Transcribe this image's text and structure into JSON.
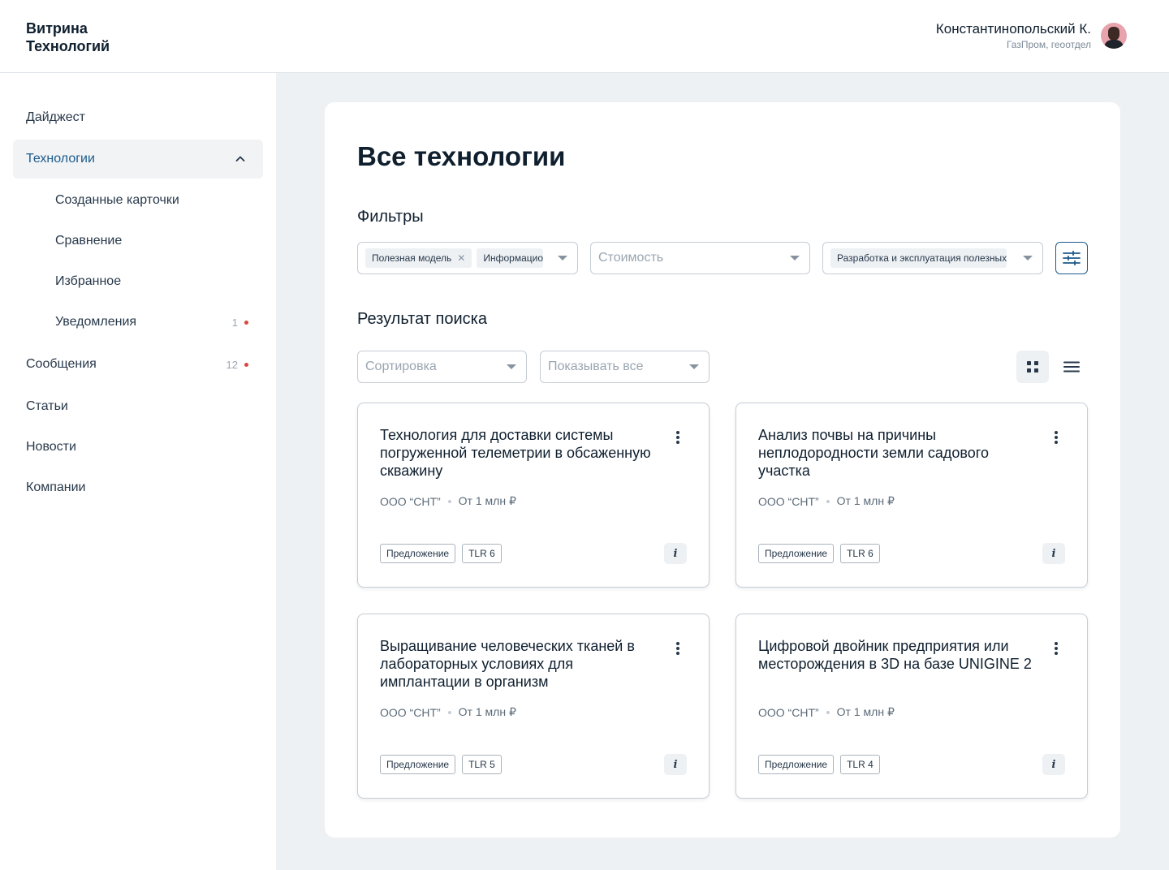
{
  "app": {
    "logo_line1": "Витрина",
    "logo_line2": "Технологий"
  },
  "user": {
    "name": "Константинопольский К.",
    "org": "ГазПром, геоотдел"
  },
  "sidebar": {
    "items": [
      {
        "label": "Дайджест"
      },
      {
        "label": "Технологии",
        "active": true
      },
      {
        "label": "Созданные карточки"
      },
      {
        "label": "Сравнение"
      },
      {
        "label": "Избранное"
      },
      {
        "label": "Уведомления",
        "count": "1"
      },
      {
        "label": "Сообщения",
        "count": "12"
      },
      {
        "label": "Статьи"
      },
      {
        "label": "Новости"
      },
      {
        "label": "Компании"
      }
    ]
  },
  "main": {
    "title": "Все технологии",
    "filters_title": "Фильтры",
    "filters": {
      "type_chips": [
        "Полезная модель",
        "Информацио"
      ],
      "cost_placeholder": "Стоимость",
      "area_chip": "Разработка и эксплуатация полезных"
    },
    "results_title": "Результат поиска",
    "sort_placeholder": "Сортировка",
    "show_placeholder": "Показывать все"
  },
  "cards": [
    {
      "title": "Технология для доставки системы погруженной телеметрии в обсаженную скважину",
      "company": "ООО “СНТ”",
      "price": "От 1 млн ₽",
      "tag_type": "Предложение",
      "tag_tlr": "TLR 6"
    },
    {
      "title": "Анализ почвы на причины неплодородности земли садового участка",
      "company": "ООО “СНТ”",
      "price": "От 1 млн ₽",
      "tag_type": "Предложение",
      "tag_tlr": "TLR 6"
    },
    {
      "title": "Выращивание человеческих тканей в лабораторных условиях для имплантации в организм",
      "company": "ООО “СНТ”",
      "price": "От 1 млн ₽",
      "tag_type": "Предложение",
      "tag_tlr": "TLR 5"
    },
    {
      "title": "Цифровой двойник предприятия или месторождения в 3D на базе UNIGINE 2",
      "company": "ООО “СНТ”",
      "price": "От 1 млн ₽",
      "tag_type": "Предложение",
      "tag_tlr": "TLR 4"
    }
  ],
  "info_label": "i",
  "colors": {
    "accent": "#1c5a8c",
    "notification_dot": "#d9473f",
    "background": "#edf1f4"
  }
}
